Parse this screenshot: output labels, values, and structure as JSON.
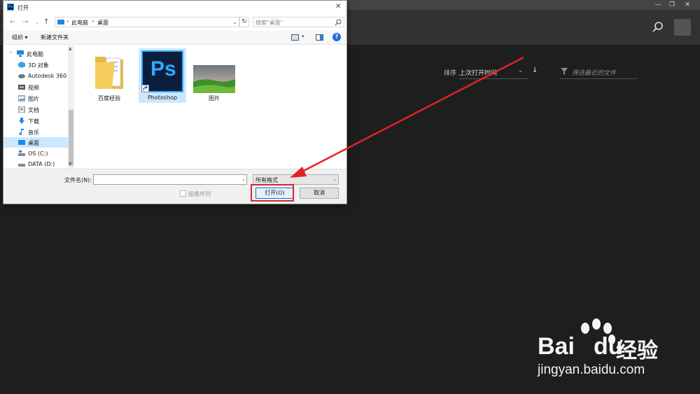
{
  "dialog": {
    "title": "打开",
    "app_icon": "Ps",
    "close_glyph": "✕",
    "address": {
      "segments": [
        "此电脑",
        "桌面"
      ],
      "separator": "›"
    },
    "search_placeholder": "搜索\"桌面\"",
    "toolbar": {
      "organize_label": "组织 ▾",
      "new_folder_label": "新建文件夹"
    },
    "nav_items": [
      {
        "label": "此电脑",
        "icon": "computer-icon"
      },
      {
        "label": "3D 对象",
        "icon": "3d-objects-icon"
      },
      {
        "label": "Autodesk 360",
        "icon": "autodesk-icon"
      },
      {
        "label": "视频",
        "icon": "video-icon"
      },
      {
        "label": "图片",
        "icon": "pictures-icon"
      },
      {
        "label": "文档",
        "icon": "documents-icon"
      },
      {
        "label": "下载",
        "icon": "download-icon"
      },
      {
        "label": "音乐",
        "icon": "music-icon"
      },
      {
        "label": "桌面",
        "icon": "desktop-icon",
        "selected": true
      },
      {
        "label": "OS (C:)",
        "icon": "drive-icon"
      },
      {
        "label": "DATA (D:)",
        "icon": "drive-icon"
      }
    ],
    "files": [
      {
        "name": "百度经验",
        "icon": "folder-icon"
      },
      {
        "name": "Photoshop",
        "icon": "photoshop-shortcut-icon",
        "selected": true
      },
      {
        "name": "图片",
        "icon": "image-thumbnail-icon"
      }
    ],
    "ps_icon_text": "Ps",
    "filename_label": "文件名(N):",
    "filename_value": "",
    "filetype_value": "所有格式",
    "image_sequence_label": "图像序列",
    "open_label": "打开(O)",
    "cancel_label": "取消"
  },
  "ps_home": {
    "sort_label": "排序",
    "sort_value": "上次打开时间",
    "sort_direction_glyph": "↓",
    "filter_placeholder": "筛选最近的文件",
    "window_controls": [
      "—",
      "❐",
      "✕"
    ]
  },
  "watermark": {
    "brand_latin_1": "Bai",
    "brand_latin_2": "du",
    "brand_cn": "经验",
    "url": "jingyan.baidu.com"
  },
  "colors": {
    "annotation_red": "#e02424",
    "ps_blue": "#31a8ff",
    "selection": "#cce8ff"
  }
}
